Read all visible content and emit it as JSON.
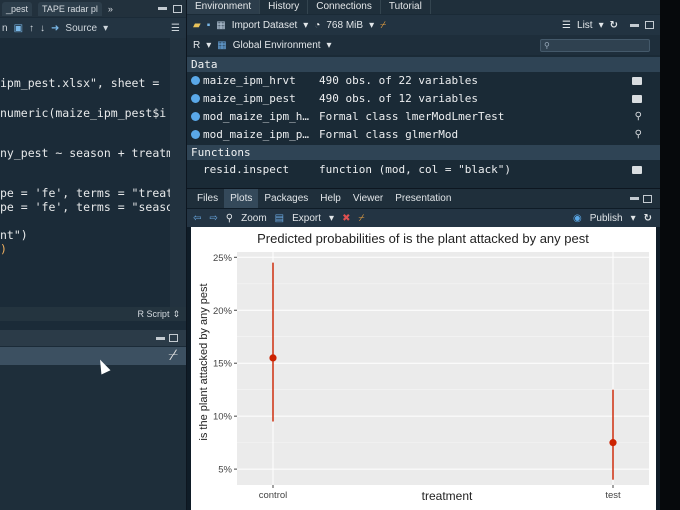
{
  "editor": {
    "tabs": [
      "_pest",
      "TAPE radar pl"
    ],
    "toolbar": {
      "source_label": "Source"
    },
    "code": [
      "",
      "ipm_pest.xlsx\", sheet =",
      "",
      "numeric(maize_ipm_pest$i",
      "",
      "",
      "ny_pest ~ season + treatm",
      "",
      "",
      "pe = 'fe', terms = \"treat",
      "pe = 'fe', terms = \"seaso",
      "",
      "nt\")",
      ")"
    ],
    "file_type": "R Script"
  },
  "environment": {
    "tabs": [
      "Environment",
      "History",
      "Connections",
      "Tutorial"
    ],
    "import_label": "Import Dataset",
    "memory": "768 MiB",
    "view_mode": "List",
    "language": "R",
    "scope": "Global Environment",
    "data_header": "Data",
    "data_rows": [
      {
        "name": "maize_ipm_hrvt",
        "value": "490 obs. of 22 variables"
      },
      {
        "name": "maize_ipm_pest",
        "value": "490 obs. of 12 variables"
      },
      {
        "name": "mod_maize_ipm_h…",
        "value": "Formal class  lmerModLmerTest"
      },
      {
        "name": "mod_maize_ipm_p…",
        "value": "Formal class  glmerMod"
      }
    ],
    "functions_header": "Functions",
    "function_rows": [
      {
        "name": "resid.inspect",
        "value": "function (mod, col = \"black\")"
      }
    ]
  },
  "plots_pane": {
    "tabs": [
      "Files",
      "Plots",
      "Packages",
      "Help",
      "Viewer",
      "Presentation"
    ],
    "active_tab": "Plots",
    "zoom_label": "Zoom",
    "export_label": "Export",
    "publish_label": "Publish"
  },
  "chart_data": {
    "type": "scatter",
    "title": "Predicted probabilities of is the plant attacked by any pest",
    "xlabel": "treatment",
    "ylabel": "is the plant attacked by any pest",
    "categories": [
      "control",
      "test"
    ],
    "series": [
      {
        "values": [
          15.5,
          7.5
        ],
        "ci_low": [
          9.5,
          4.0
        ],
        "ci_high": [
          24.5,
          12.5
        ]
      }
    ],
    "yticks": [
      5,
      10,
      15,
      20,
      25
    ],
    "ytick_labels": [
      "5%",
      "10%",
      "15%",
      "20%",
      "25%"
    ],
    "ylim": [
      3.5,
      25.5
    ],
    "grid": true,
    "point_color": "#cc2200"
  },
  "colors": {
    "editor_bg": "#1b2b38",
    "accent": "#5aa8e8"
  }
}
